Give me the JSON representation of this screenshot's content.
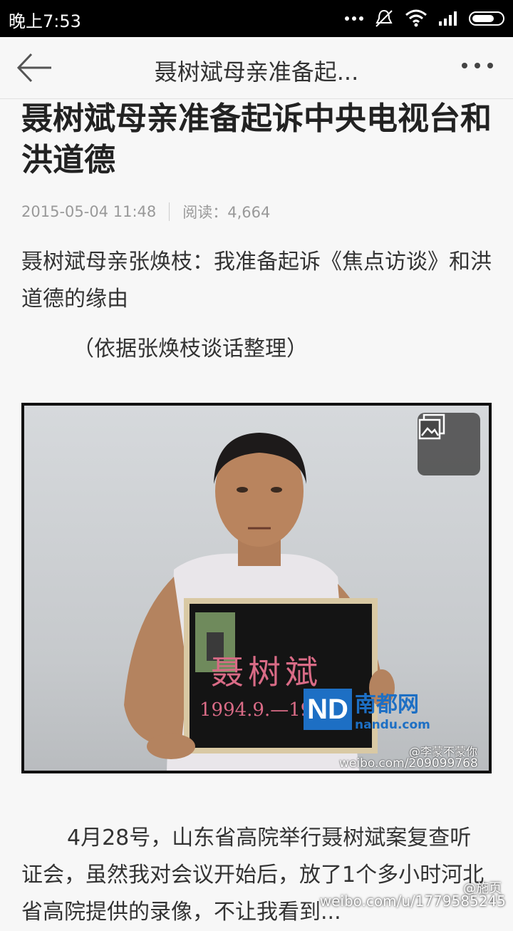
{
  "status_bar": {
    "time": "晚上7:53"
  },
  "nav": {
    "title": "聂树斌母亲准备起..."
  },
  "article": {
    "title": "聂树斌母亲准备起诉中央电视台和洪道德",
    "date": "2015-05-04 11:48",
    "read_count": "阅读：4,664",
    "subtitle": "聂树斌母亲张焕枝：我准备起诉《焦点访谈》和洪道德的缘由",
    "note": "（依据张焕枝谈话整理）",
    "body": "4月28号，山东省高院举行聂树斌案复查听证会，虽然我对会议开始后，放了1个多小时河北省高院提供的录像，不让我看到..."
  },
  "photo": {
    "board_text": "聂树斌",
    "board_date": "1994.9.—19",
    "logo_main": "南都网",
    "logo_sub": "nandu.com",
    "weibo_user": "@李蒙不蒙你",
    "weibo_url": "weibo.com/209099768"
  },
  "watermark": {
    "user": "@施页",
    "url": "weibo.com/u/1779585245"
  },
  "icons": [
    "back-arrow-icon",
    "more-dots-icon",
    "gallery-icon",
    "mute-icon",
    "wifi-icon",
    "signal-icon",
    "battery-icon"
  ]
}
